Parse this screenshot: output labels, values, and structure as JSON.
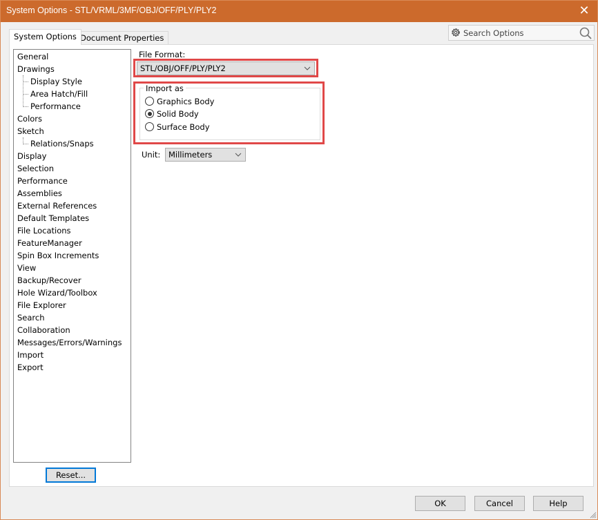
{
  "window": {
    "title": "System Options - STL/VRML/3MF/OBJ/OFF/PLY/PLY2",
    "close_icon": "close-icon"
  },
  "tabs": [
    {
      "label": "System Options",
      "active": true
    },
    {
      "label": "Document Properties",
      "active": false
    }
  ],
  "search": {
    "placeholder": "Search Options",
    "left_icon": "gear-icon",
    "right_icon": "search-icon"
  },
  "tree": {
    "items": [
      {
        "label": "General",
        "level": 0
      },
      {
        "label": "Drawings",
        "level": 0
      },
      {
        "label": "Display Style",
        "level": 1
      },
      {
        "label": "Area Hatch/Fill",
        "level": 1
      },
      {
        "label": "Performance",
        "level": 1
      },
      {
        "label": "Colors",
        "level": 0
      },
      {
        "label": "Sketch",
        "level": 0
      },
      {
        "label": "Relations/Snaps",
        "level": 1
      },
      {
        "label": "Display",
        "level": 0
      },
      {
        "label": "Selection",
        "level": 0
      },
      {
        "label": "Performance",
        "level": 0
      },
      {
        "label": "Assemblies",
        "level": 0
      },
      {
        "label": "External References",
        "level": 0
      },
      {
        "label": "Default Templates",
        "level": 0
      },
      {
        "label": "File Locations",
        "level": 0
      },
      {
        "label": "FeatureManager",
        "level": 0
      },
      {
        "label": "Spin Box Increments",
        "level": 0
      },
      {
        "label": "View",
        "level": 0
      },
      {
        "label": "Backup/Recover",
        "level": 0
      },
      {
        "label": "Hole Wizard/Toolbox",
        "level": 0
      },
      {
        "label": "File Explorer",
        "level": 0
      },
      {
        "label": "Search",
        "level": 0
      },
      {
        "label": "Collaboration",
        "level": 0
      },
      {
        "label": "Messages/Errors/Warnings",
        "level": 0
      },
      {
        "label": "Import",
        "level": 0
      },
      {
        "label": "Export",
        "level": 0
      }
    ],
    "reset_label": "Reset..."
  },
  "content": {
    "file_format_label": "File Format:",
    "file_format_value": "STL/OBJ/OFF/PLY/PLY2",
    "import_as": {
      "title": "Import as",
      "options": [
        {
          "label": "Graphics Body",
          "selected": false
        },
        {
          "label": "Solid Body",
          "selected": true
        },
        {
          "label": "Surface Body",
          "selected": false
        }
      ]
    },
    "unit_label": "Unit:",
    "unit_value": "Millimeters",
    "highlight_color": "#e04848"
  },
  "buttons": {
    "ok": "OK",
    "cancel": "Cancel",
    "help": "Help"
  },
  "colors": {
    "titlebar": "#cc6a2c",
    "focus_border": "#0078d7"
  }
}
